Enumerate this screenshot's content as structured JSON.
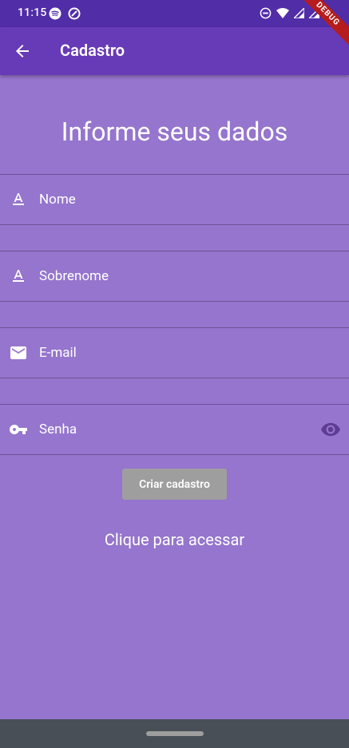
{
  "status_bar": {
    "time": "11:15",
    "left_icons": [
      "spotify-icon",
      "app-icon"
    ],
    "right_icons": [
      "do-not-disturb-icon",
      "wifi-icon",
      "signal-icon",
      "signal-icon",
      "battery-icon"
    ],
    "debug_label": "DEBUG"
  },
  "app_bar": {
    "title": "Cadastro",
    "back_icon": "arrow-back-icon"
  },
  "form": {
    "heading": "Informe seus dados",
    "fields": [
      {
        "label": "Nome",
        "icon": "text-format-icon",
        "value": ""
      },
      {
        "label": "Sobrenome",
        "icon": "text-format-icon",
        "value": ""
      },
      {
        "label": "E-mail",
        "icon": "mail-icon",
        "value": ""
      },
      {
        "label": "Senha",
        "icon": "key-icon",
        "value": "",
        "suffix_icon": "visibility-icon"
      }
    ],
    "submit_label": "Criar cadastro",
    "access_link": "Clique para acessar"
  },
  "colors": {
    "background": "#9575CD",
    "app_bar": "#673AB7",
    "status_bar": "#512DA8",
    "button_disabled": "#9E9E9E",
    "nav_bar": "#484F56"
  }
}
